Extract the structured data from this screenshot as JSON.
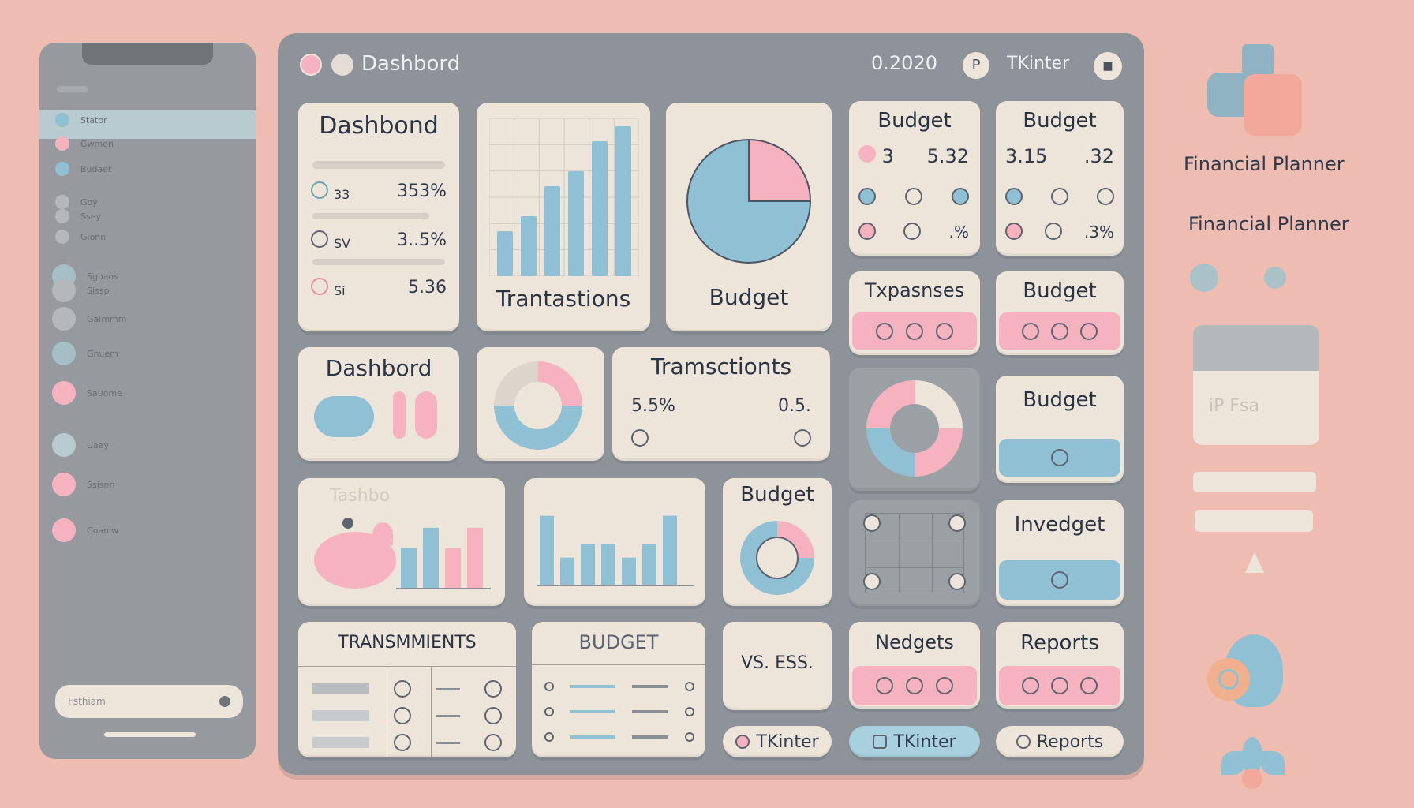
{
  "titlebar": {
    "title": "Dashbord",
    "date": "0.2020",
    "user": "TKinter"
  },
  "sidebar": {
    "items": [
      "Stator",
      "Gwmon",
      "Budaet",
      "Goy",
      "Ssey",
      "Gionn",
      "Sgoaos",
      "Sissp",
      "Gaimmm",
      "Gnuem",
      "Sauome",
      "Uaay",
      "Ssisnn",
      "Coaniw"
    ],
    "input_value": "Fsthiam"
  },
  "cards": {
    "dashboard1": {
      "title": "Dashbond",
      "row1_label": "33",
      "row1_value": "353%",
      "row2_label": "SV",
      "row2_value": "3..5%",
      "row3_label": "Si",
      "row3_value": "5.36"
    },
    "transactions1": {
      "title": "Trantastions"
    },
    "budget_pie": {
      "title": "Budget"
    },
    "budget_a": {
      "title": "Budget",
      "v1": "3",
      "v2": "5.32"
    },
    "budget_b": {
      "title": "Budget",
      "v1": "3.15",
      "v2": ".32",
      "v3": ".3%"
    },
    "budget_a_pct": ".%",
    "expenses": {
      "title": "Txpasnses"
    },
    "budget_c": {
      "title": "Budget"
    },
    "dashboard2": {
      "title": "Dashbord"
    },
    "transactions2": {
      "title": "Tramsctionts",
      "v1": "5.5%",
      "v2": "0.5."
    },
    "budget_d": {
      "title": "Budget"
    },
    "invedget": {
      "title": "Invedget"
    },
    "dashboard3": {
      "title": "Tashbo"
    },
    "budget_e": {
      "title": "Budget"
    },
    "transmiments": {
      "title": "TRANSMMIENTS"
    },
    "budget_list": {
      "title": "BUDGET"
    },
    "vs": {
      "title": "VS. ESS."
    },
    "nedgets": {
      "title": "Nedgets"
    },
    "reports": {
      "title": "Reports"
    }
  },
  "bottom_buttons": [
    "TKinter",
    "TKinter",
    "Reports"
  ],
  "right_panel": {
    "label1": "Financial Planner",
    "label2": "Financial Planner",
    "card_text": "iP Fsa"
  },
  "chart_data": [
    {
      "type": "bar",
      "values": [
        3,
        4,
        6,
        7,
        9,
        10
      ]
    },
    {
      "type": "pie",
      "values": [
        75,
        25
      ]
    },
    {
      "type": "bar",
      "values": [
        4,
        6,
        4,
        6
      ]
    },
    {
      "type": "bar",
      "values": [
        5,
        2,
        3,
        3,
        2,
        3,
        5
      ]
    }
  ],
  "colors": {
    "background": "#eebcb0",
    "panel": "#8e9399",
    "card": "#ede5da",
    "blue": "#8fc0d3",
    "pink": "#f6b3bf",
    "text": "#2b3444"
  }
}
